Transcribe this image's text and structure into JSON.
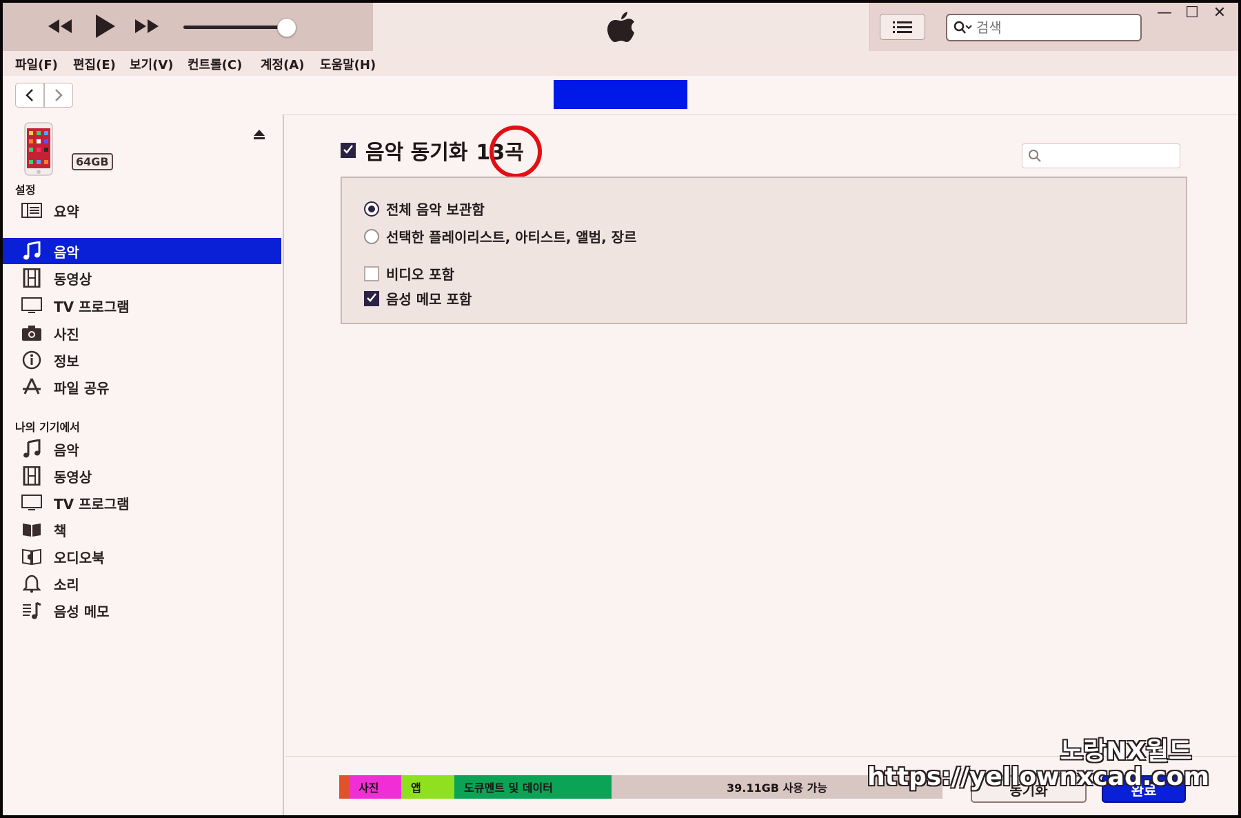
{
  "menu": [
    "파일(F)",
    "편집(E)",
    "보기(V)",
    "컨트롤(C)",
    "계정(A)",
    "도움말(H)"
  ],
  "search": {
    "placeholder": "검색"
  },
  "device": {
    "capacity": "64GB"
  },
  "sidebar": {
    "settings_header": "설정",
    "settings": [
      {
        "label": "요약",
        "icon": "summary-icon"
      },
      {
        "label": "음악",
        "icon": "music-note-icon",
        "selected": true
      },
      {
        "label": "동영상",
        "icon": "film-icon"
      },
      {
        "label": "TV 프로그램",
        "icon": "tv-icon"
      },
      {
        "label": "사진",
        "icon": "camera-icon"
      },
      {
        "label": "정보",
        "icon": "info-icon"
      },
      {
        "label": "파일 공유",
        "icon": "app-store-icon"
      }
    ],
    "device_header": "나의 기기에서",
    "on_device": [
      {
        "label": "음악",
        "icon": "music-note-icon"
      },
      {
        "label": "동영상",
        "icon": "film-icon"
      },
      {
        "label": "TV 프로그램",
        "icon": "tv-icon"
      },
      {
        "label": "책",
        "icon": "book-icon"
      },
      {
        "label": "오디오북",
        "icon": "audiobook-icon"
      },
      {
        "label": "소리",
        "icon": "bell-icon"
      },
      {
        "label": "음성 메모",
        "icon": "voice-memo-icon"
      }
    ]
  },
  "main": {
    "sync_title": "음악 동기화",
    "sync_count": "13곡",
    "sync_checked": true,
    "options": {
      "entire_library": "전체 음악 보관함",
      "selected": "선택한 플레이리스트, 아티스트, 앨범, 장르",
      "include_video": "비디오 포함",
      "include_voice_memos": "음성 메모 포함"
    }
  },
  "storage": {
    "segments": [
      {
        "label": "",
        "color": "#e0532a",
        "fraction": 0.011
      },
      {
        "label": "사진",
        "color": "#f12ed6",
        "fraction": 0.087
      },
      {
        "label": "앱",
        "color": "#8fe01e",
        "fraction": 0.088
      },
      {
        "label": "도큐멘트 및 데이터",
        "color": "#0ba356",
        "fraction": 0.262
      },
      {
        "label": "39.11GB 사용 가능",
        "color": "#d8c6c3",
        "fraction": 0.552
      }
    ],
    "sync_button": "동기화",
    "done_button": "완료"
  },
  "watermark": {
    "line1": "노랑NX월드",
    "line2": "https://yellownxcad.com"
  },
  "colors": {
    "selection": "#0a20d6",
    "device_tab": "#0018e8",
    "highlight_circle": "#e10f14"
  }
}
